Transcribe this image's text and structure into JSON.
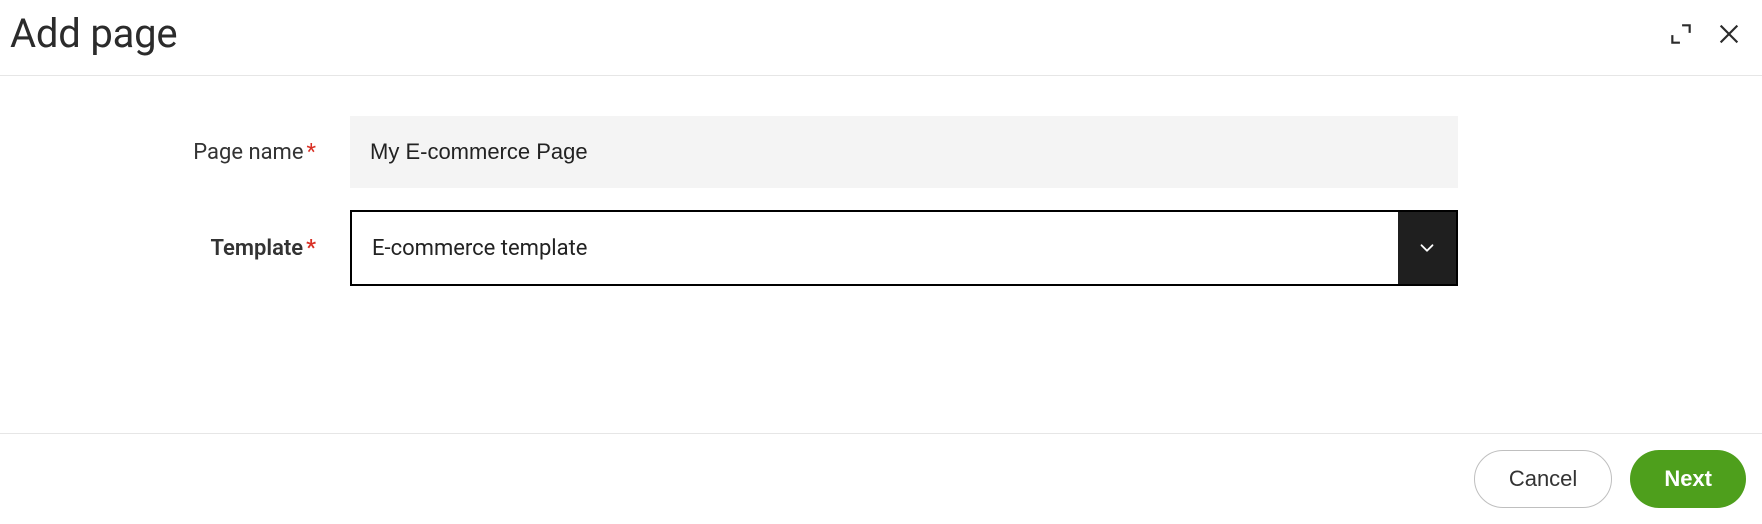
{
  "dialog": {
    "title": "Add page"
  },
  "form": {
    "pageName": {
      "label": "Page name",
      "required": "*",
      "value": "My E-commerce Page"
    },
    "template": {
      "label": "Template",
      "required": "*",
      "selected": "E-commerce template"
    }
  },
  "footer": {
    "cancel": "Cancel",
    "next": "Next"
  }
}
